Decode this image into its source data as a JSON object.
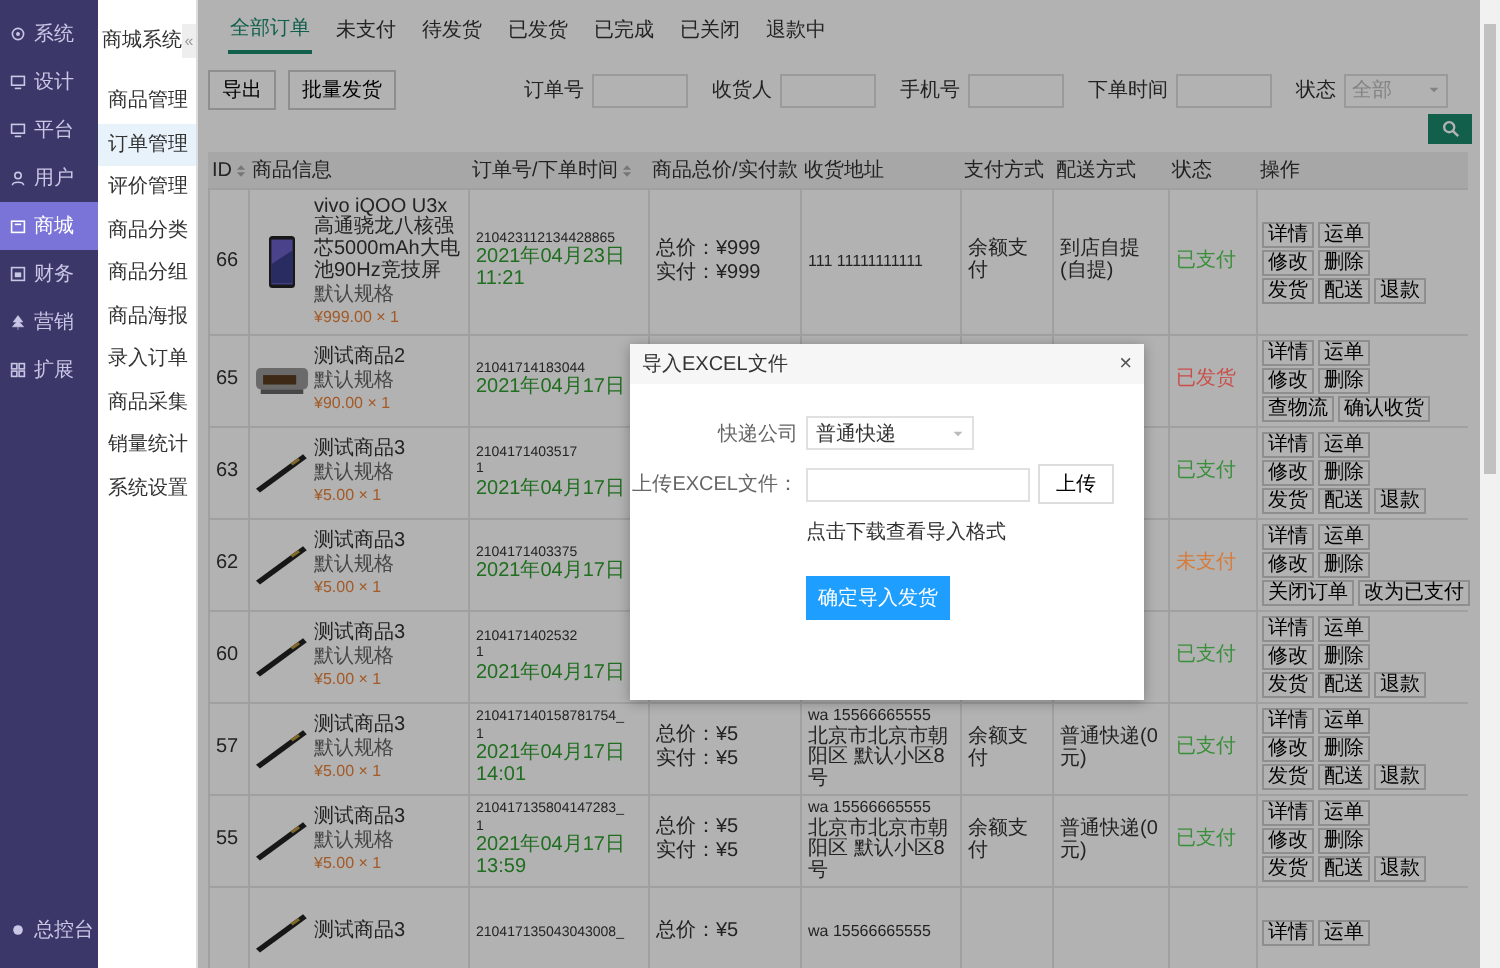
{
  "nav": {
    "items": [
      {
        "label": "系统",
        "selected": false
      },
      {
        "label": "设计",
        "selected": false
      },
      {
        "label": "平台",
        "selected": false
      },
      {
        "label": "用户",
        "selected": false
      },
      {
        "label": "商城",
        "selected": true
      },
      {
        "label": "财务",
        "selected": false
      },
      {
        "label": "营销",
        "selected": false
      },
      {
        "label": "扩展",
        "selected": false
      }
    ],
    "footer": "总控台"
  },
  "subnav": {
    "title": "商城系统",
    "collapse": "«",
    "items": [
      {
        "label": "商品管理",
        "selected": false
      },
      {
        "label": "订单管理",
        "selected": true
      },
      {
        "label": "评价管理",
        "selected": false
      },
      {
        "label": "商品分类",
        "selected": false
      },
      {
        "label": "商品分组",
        "selected": false
      },
      {
        "label": "商品海报",
        "selected": false
      },
      {
        "label": "录入订单",
        "selected": false
      },
      {
        "label": "商品采集",
        "selected": false
      },
      {
        "label": "销量统计",
        "selected": false
      },
      {
        "label": "系统设置",
        "selected": false
      }
    ]
  },
  "tabs": [
    {
      "label": "全部订单",
      "selected": true
    },
    {
      "label": "未支付",
      "selected": false
    },
    {
      "label": "待发货",
      "selected": false
    },
    {
      "label": "已发货",
      "selected": false
    },
    {
      "label": "已完成",
      "selected": false
    },
    {
      "label": "已关闭",
      "selected": false
    },
    {
      "label": "退款中",
      "selected": false
    }
  ],
  "toolbar": {
    "buttons": [
      "导出",
      "批量发货"
    ],
    "filters": [
      {
        "label": "订单号"
      },
      {
        "label": "收货人"
      },
      {
        "label": "手机号"
      },
      {
        "label": "下单时间"
      }
    ],
    "status_filter": {
      "label": "状态",
      "value": "全部"
    }
  },
  "table": {
    "columns": [
      {
        "label": "ID",
        "sortable": true
      },
      {
        "label": "商品信息"
      },
      {
        "label": "订单号/下单时间",
        "sortable": true
      },
      {
        "label": "商品总价/实付款"
      },
      {
        "label": "收货地址"
      },
      {
        "label": "支付方式"
      },
      {
        "label": "配送方式"
      },
      {
        "label": "状态"
      },
      {
        "label": "操作"
      }
    ],
    "rows": [
      {
        "id": "66",
        "name": "vivo iQOO U3x 高通骁龙八核强芯5000mAh大电池90Hz竞技屏",
        "spec": "默认规格",
        "price": "¥999.00 × 1",
        "order_no": [
          "210423112134428865"
        ],
        "date": "2021年04月23日 11:21",
        "total": "总价：¥999",
        "paid": "实付：¥999",
        "address": [
          "111 11111111111"
        ],
        "pay": "余额支付",
        "delivery": "到店自提(自提)",
        "status": "已支付",
        "color": "#3a8f3a",
        "actions": [
          [
            "详情",
            "运单"
          ],
          [
            "修改",
            "删除"
          ],
          [
            "发货",
            "配送",
            "退款"
          ]
        ]
      },
      {
        "id": "65",
        "name": "测试商品2",
        "spec": "默认规格",
        "price": "¥90.00 × 1",
        "order_no": [
          "21041714183044"
        ],
        "date": "2021年04月17日",
        "status": "已发货",
        "color": "#c9504a",
        "actions": [
          [
            "详情",
            "运单"
          ],
          [
            "修改",
            "删除"
          ],
          [
            "查物流",
            "确认收货"
          ]
        ]
      },
      {
        "id": "63",
        "name": "测试商品3",
        "spec": "默认规格",
        "price": "¥5.00 × 1",
        "order_no": [
          "2104171403517",
          "1"
        ],
        "date": "2021年04月17日",
        "status": "已支付",
        "color": "#3a8f3a",
        "actions": [
          [
            "详情",
            "运单"
          ],
          [
            "修改",
            "删除"
          ],
          [
            "发货",
            "配送",
            "退款"
          ]
        ]
      },
      {
        "id": "62",
        "name": "测试商品3",
        "spec": "默认规格",
        "price": "¥5.00 × 1",
        "order_no": [
          "2104171403375"
        ],
        "date": "2021年04月17日",
        "status": "未支付",
        "color": "#d77b3a",
        "actions": [
          [
            "详情",
            "运单"
          ],
          [
            "修改",
            "删除"
          ],
          [
            "关闭订单",
            "改为已支付"
          ]
        ]
      },
      {
        "id": "60",
        "name": "测试商品3",
        "spec": "默认规格",
        "price": "¥5.00 × 1",
        "order_no": [
          "2104171402532",
          "1"
        ],
        "date": "2021年04月17日",
        "status": "已支付",
        "color": "#3a8f3a",
        "actions": [
          [
            "详情",
            "运单"
          ],
          [
            "修改",
            "删除"
          ],
          [
            "发货",
            "配送",
            "退款"
          ]
        ]
      },
      {
        "id": "57",
        "name": "测试商品3",
        "spec": "默认规格",
        "price": "¥5.00 × 1",
        "order_no": [
          "210417140158781754_",
          "1"
        ],
        "date": "2021年04月17日 14:01",
        "total": "总价：¥5",
        "paid": "实付：¥5",
        "address": [
          "wa 15566665555",
          "北京市北京市朝阳区 默认小区8号"
        ],
        "pay": "余额支付",
        "delivery": "普通快递(0元)",
        "status": "已支付",
        "color": "#3a8f3a",
        "actions": [
          [
            "详情",
            "运单"
          ],
          [
            "修改",
            "删除"
          ],
          [
            "发货",
            "配送",
            "退款"
          ]
        ]
      },
      {
        "id": "55",
        "name": "测试商品3",
        "spec": "默认规格",
        "price": "¥5.00 × 1",
        "order_no": [
          "210417135804147283_",
          "1"
        ],
        "date": "2021年04月17日 13:59",
        "total": "总价：¥5",
        "paid": "实付：¥5",
        "address": [
          "wa 15566665555",
          "北京市北京市朝阳区 默认小区8号"
        ],
        "pay": "余额支付",
        "delivery": "普通快递(0元)",
        "status": "已支付",
        "color": "#3a8f3a",
        "actions": [
          [
            "详情",
            "运单"
          ],
          [
            "修改",
            "删除"
          ],
          [
            "发货",
            "配送",
            "退款"
          ]
        ]
      },
      {
        "name": "测试商品3",
        "order_no": [
          "210417135043043008_"
        ],
        "total": "总价：¥5",
        "address": [
          "wa 15566665555"
        ],
        "actions": [
          [
            "详情",
            "运单"
          ]
        ]
      }
    ]
  },
  "modal": {
    "title": "导入EXCEL文件",
    "close": "×",
    "company_label": "快递公司",
    "company_value": "普通快递",
    "file_label": "上传EXCEL文件：",
    "upload_button": "上传",
    "template_link": "点击下载查看导入格式",
    "submit": "确定导入发货"
  }
}
